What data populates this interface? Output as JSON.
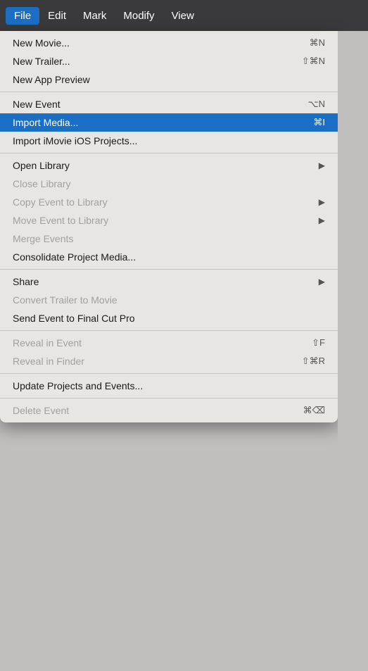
{
  "menuBar": {
    "items": [
      {
        "label": "File",
        "active": true
      },
      {
        "label": "Edit",
        "active": false
      },
      {
        "label": "Mark",
        "active": false
      },
      {
        "label": "Modify",
        "active": false
      },
      {
        "label": "View",
        "active": false
      }
    ]
  },
  "dropdown": {
    "sections": [
      {
        "items": [
          {
            "label": "New Movie...",
            "shortcut": "⌘N",
            "disabled": false,
            "highlighted": false,
            "hasArrow": false
          },
          {
            "label": "New Trailer...",
            "shortcut": "⇧⌘N",
            "disabled": false,
            "highlighted": false,
            "hasArrow": false
          },
          {
            "label": "New App Preview",
            "shortcut": "",
            "disabled": false,
            "highlighted": false,
            "hasArrow": false
          }
        ]
      },
      {
        "items": [
          {
            "label": "New Event",
            "shortcut": "⌥N",
            "disabled": false,
            "highlighted": false,
            "hasArrow": false
          },
          {
            "label": "Import Media...",
            "shortcut": "⌘I",
            "disabled": false,
            "highlighted": true,
            "hasArrow": false
          },
          {
            "label": "Import iMovie iOS Projects...",
            "shortcut": "",
            "disabled": false,
            "highlighted": false,
            "hasArrow": false
          }
        ]
      },
      {
        "items": [
          {
            "label": "Open Library",
            "shortcut": "",
            "disabled": false,
            "highlighted": false,
            "hasArrow": true
          },
          {
            "label": "Close Library",
            "shortcut": "",
            "disabled": true,
            "highlighted": false,
            "hasArrow": false
          },
          {
            "label": "Copy Event to Library",
            "shortcut": "",
            "disabled": true,
            "highlighted": false,
            "hasArrow": true
          },
          {
            "label": "Move Event to Library",
            "shortcut": "",
            "disabled": true,
            "highlighted": false,
            "hasArrow": true
          },
          {
            "label": "Merge Events",
            "shortcut": "",
            "disabled": true,
            "highlighted": false,
            "hasArrow": false
          },
          {
            "label": "Consolidate Project Media...",
            "shortcut": "",
            "disabled": false,
            "highlighted": false,
            "hasArrow": false
          }
        ]
      },
      {
        "items": [
          {
            "label": "Share",
            "shortcut": "",
            "disabled": false,
            "highlighted": false,
            "hasArrow": true
          },
          {
            "label": "Convert Trailer to Movie",
            "shortcut": "",
            "disabled": true,
            "highlighted": false,
            "hasArrow": false
          },
          {
            "label": "Send Event to Final Cut Pro",
            "shortcut": "",
            "disabled": false,
            "highlighted": false,
            "hasArrow": false
          }
        ]
      },
      {
        "items": [
          {
            "label": "Reveal in Event",
            "shortcut": "⇧F",
            "disabled": true,
            "highlighted": false,
            "hasArrow": false
          },
          {
            "label": "Reveal in Finder",
            "shortcut": "⇧⌘R",
            "disabled": true,
            "highlighted": false,
            "hasArrow": false
          }
        ]
      },
      {
        "items": [
          {
            "label": "Update Projects and Events...",
            "shortcut": "",
            "disabled": false,
            "highlighted": false,
            "hasArrow": false
          }
        ]
      },
      {
        "items": [
          {
            "label": "Delete Event",
            "shortcut": "⌘⌫",
            "disabled": true,
            "highlighted": false,
            "hasArrow": false
          }
        ]
      }
    ]
  }
}
